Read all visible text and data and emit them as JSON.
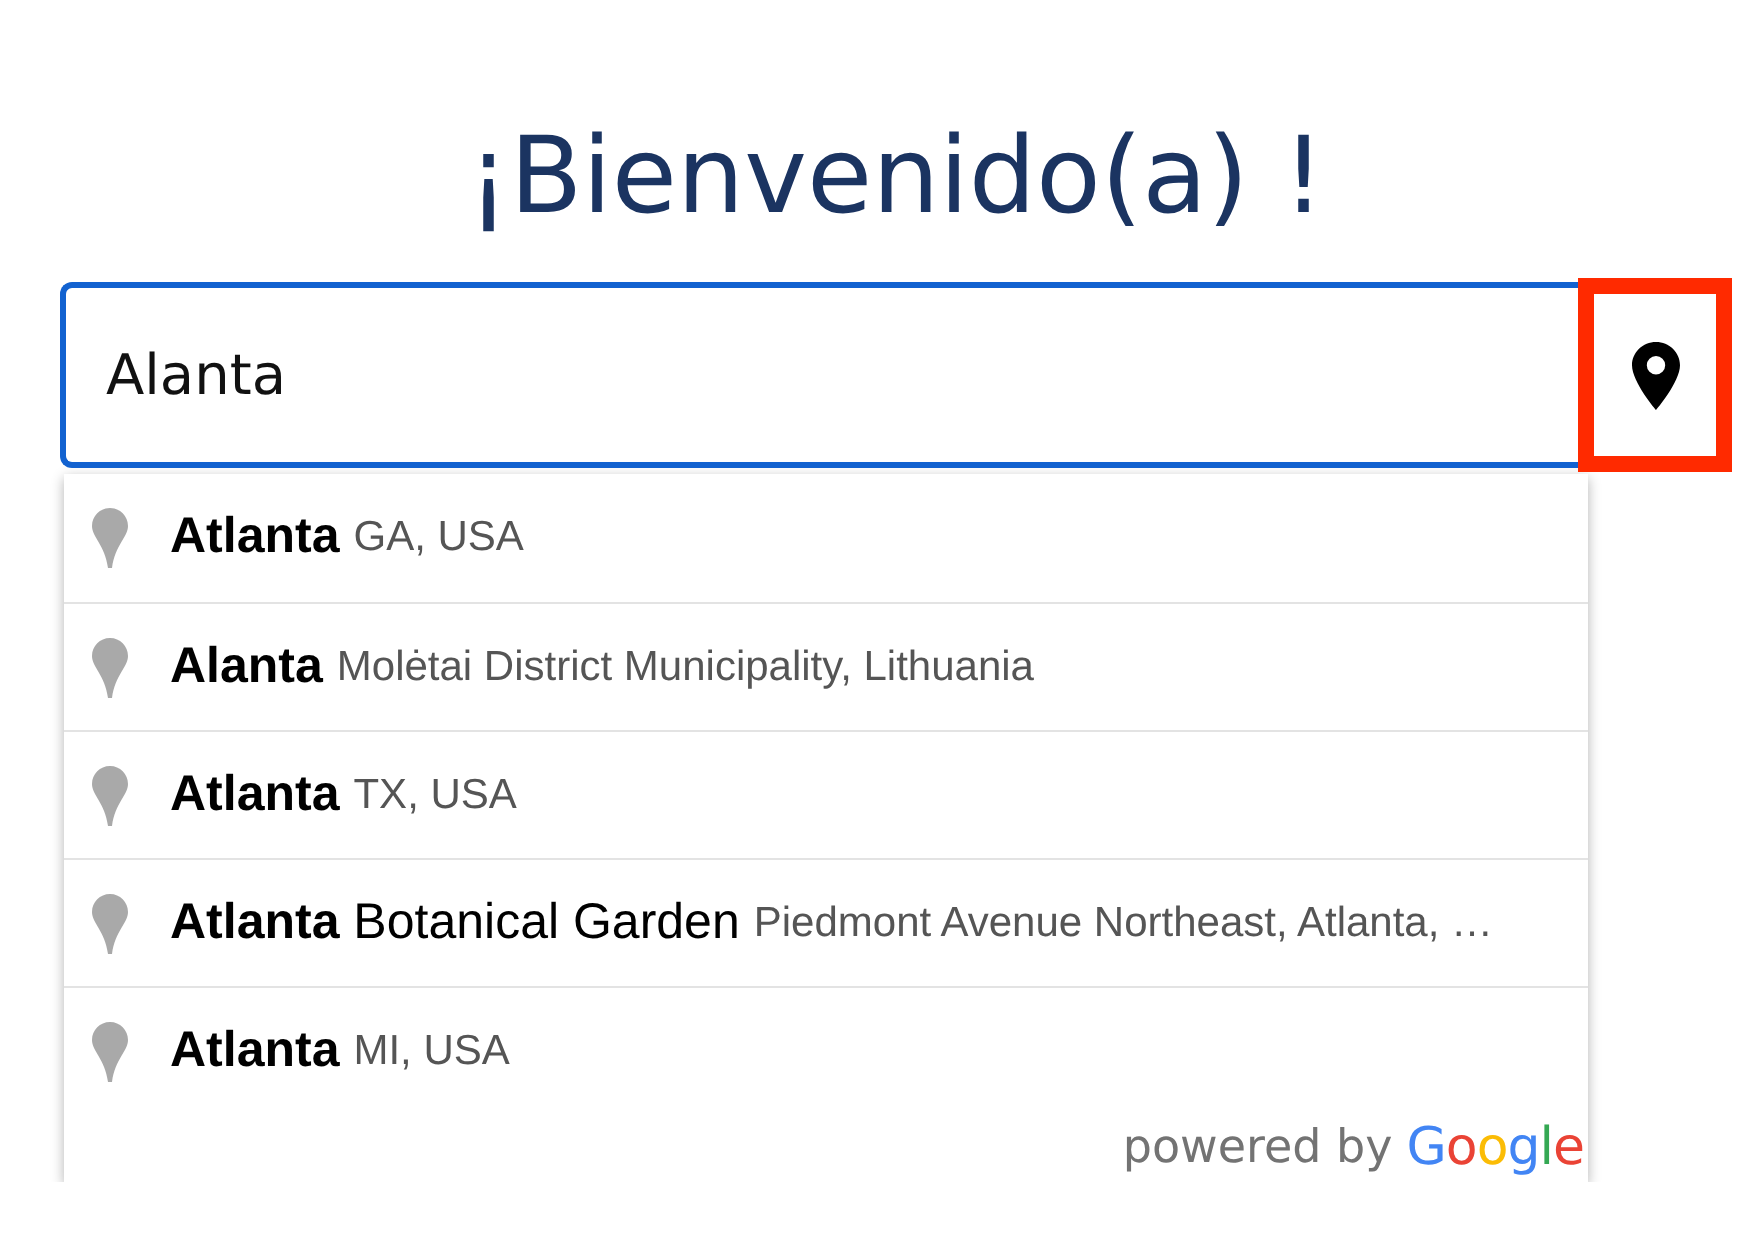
{
  "heading": "¡Bienvenido(a) !",
  "search": {
    "value": "Alanta"
  },
  "location_button": {
    "highlighted": true
  },
  "suggestions": [
    {
      "title": "**Atlanta**",
      "detail": "GA, USA"
    },
    {
      "title": "**Alanta**",
      "detail": "Molėtai District Municipality, Lithuania"
    },
    {
      "title": "**Atlanta**",
      "detail": "TX, USA"
    },
    {
      "title": "**Atlanta** Botanical Garden",
      "detail": "Piedmont Avenue Northeast, Atlanta, …"
    },
    {
      "title": "**Atlanta**",
      "detail": "MI, USA"
    }
  ],
  "attribution": {
    "text": "powered by",
    "logo": "Google"
  }
}
